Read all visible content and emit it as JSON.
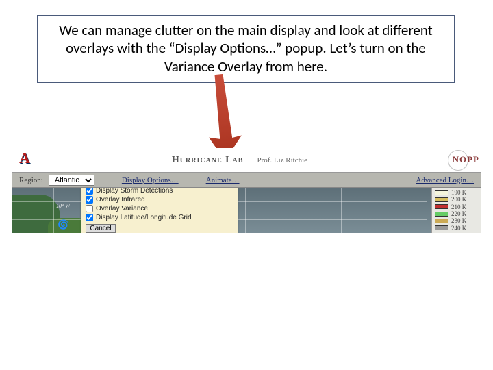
{
  "caption": "We can manage clutter on the main display and look at different overlays with the “Display Options…” popup.  Let’s turn on the Variance Overlay from here.",
  "header": {
    "lab_title": "Hurricane Lab",
    "professor": "Prof. Liz Ritchie",
    "nopp": "NOPP"
  },
  "toolbar": {
    "region_label": "Region:",
    "region_value": "Atlantic",
    "display_options": "Display Options…",
    "animate": "Animate…",
    "advanced_login": "Advanced Login…"
  },
  "popup": {
    "options": [
      {
        "label": "Display Storm Detections",
        "checked": true
      },
      {
        "label": "Overlay Infrared",
        "checked": true
      },
      {
        "label": "Overlay Variance",
        "checked": false
      },
      {
        "label": "Display Latitude/Longitude Grid",
        "checked": true
      }
    ],
    "cancel": "Cancel"
  },
  "map": {
    "lat_label": "10° W",
    "hurricane_glyph": "🌀"
  },
  "legend": [
    {
      "label": "190 K",
      "color": "#f5f5dc"
    },
    {
      "label": "200 K",
      "color": "#d8c060"
    },
    {
      "label": "210 K",
      "color": "#c03030"
    },
    {
      "label": "220 K",
      "color": "#66cc66"
    },
    {
      "label": "230 K",
      "color": "#ccaa55"
    },
    {
      "label": "240 K",
      "color": "#999999"
    }
  ]
}
